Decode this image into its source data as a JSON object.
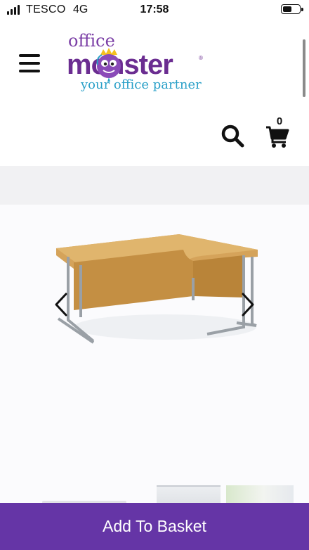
{
  "status_bar": {
    "carrier": "TESCO",
    "network": "4G",
    "time": "17:58",
    "battery_level": 0.55
  },
  "header": {
    "logo": {
      "word_top": "office",
      "word_main": "monster",
      "registered_mark": "®",
      "tagline": "your office partner",
      "colors": {
        "purple": "#6b2d91",
        "light_purple": "#7b3fa6",
        "blue": "#2aa0c8"
      }
    },
    "menu_icon": "hamburger-icon",
    "search_icon": "search-icon",
    "cart_icon": "cart-icon",
    "cart_count": "0"
  },
  "gallery": {
    "product_image": "ergonomic-corner-desk-oak",
    "prev_icon": "chevron-left-icon",
    "next_icon": "chevron-right-icon"
  },
  "add_to_basket": {
    "label": "Add To Basket",
    "color": "#6535a6"
  }
}
